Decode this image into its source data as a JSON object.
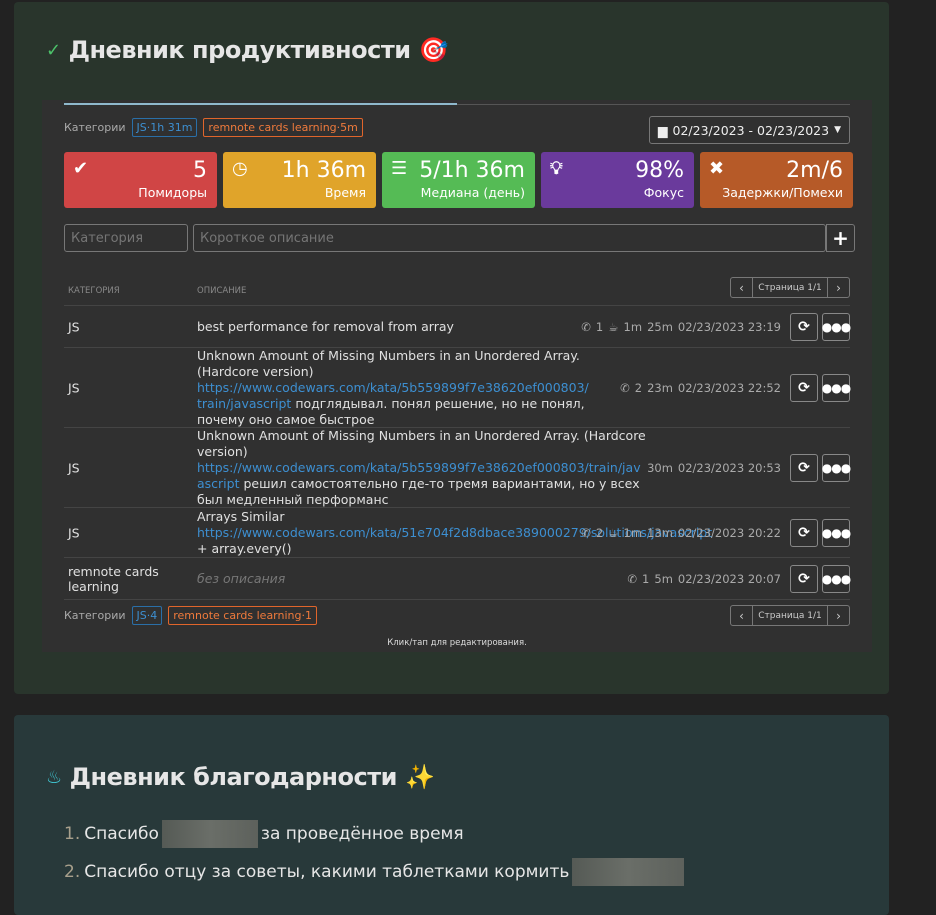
{
  "productivity": {
    "title": "Дневник продуктивности",
    "title_emoji": "🎯",
    "categories_label": "Категории",
    "top_tags": [
      "JS·1h 31m",
      "remnote cards learning·5m"
    ],
    "date_range": "02/23/2023 - 02/23/2023",
    "stats": [
      {
        "value": "5",
        "label": "Помидоры",
        "color": "#d04545",
        "icon": "check-circle-icon"
      },
      {
        "value": "1h 36m",
        "label": "Время",
        "color": "#e0a42a",
        "icon": "clock-icon"
      },
      {
        "value": "5/1h 36m",
        "label": "Медиана (день)",
        "color": "#55bb55",
        "icon": "list-icon"
      },
      {
        "value": "98%",
        "label": "Фокус",
        "color": "#6a3a9c",
        "icon": "lightbulb-icon"
      },
      {
        "value": "2m/6",
        "label": "Задержки/Помехи",
        "color": "#b65a28",
        "icon": "x-icon"
      }
    ],
    "category_placeholder": "Категория",
    "description_placeholder": "Короткое описание",
    "add_label": "+",
    "columns": {
      "category": "КАТЕГОРИЯ",
      "description": "ОПИСАНИЕ"
    },
    "page_label": "Страница 1/1",
    "rows": [
      {
        "category": "JS",
        "title": "best performance for removal from array",
        "link": "",
        "note": "",
        "calls": "1",
        "breaks": "1m",
        "duration": "25m",
        "datetime": "02/23/2023 23:19"
      },
      {
        "category": "JS",
        "title": "Unknown Amount of Missing Numbers in an Unordered Array. (Hardcore version)",
        "link": "https://www.codewars.com/kata/5b559899f7e38620ef000803/train/javascript",
        "note": "подглядывал. понял решение, но не понял, почему оно самое быстрое",
        "calls": "2",
        "breaks": "",
        "duration": "23m",
        "datetime": "02/23/2023 22:52"
      },
      {
        "category": "JS",
        "title": "Unknown Amount of Missing Numbers in an Unordered Array. (Hardcore version)",
        "link": "https://www.codewars.com/kata/5b559899f7e38620ef000803/train/javascript",
        "note": "решил самостоятельно где-то тремя вариантами, но у всех был медленный перформанс",
        "calls": "",
        "breaks": "",
        "duration": "30m",
        "datetime": "02/23/2023 20:53"
      },
      {
        "category": "JS",
        "title": "Arrays Similar",
        "link": "https://www.codewars.com/kata/51e704f2d8dbace389000279/solutions/javascript",
        "note": "+ array.every()",
        "calls": "2",
        "breaks": "1m",
        "duration": "13m",
        "datetime": "02/23/2023 20:22"
      },
      {
        "category": "remnote cards learning",
        "title": "без описания",
        "link": "",
        "note": "",
        "calls": "1",
        "breaks": "",
        "duration": "5m",
        "datetime": "02/23/2023 20:07"
      }
    ],
    "bottom_tags": [
      "JS·4",
      "remnote cards learning·1"
    ],
    "hint": "Клик/тап для редактирования."
  },
  "gratitude": {
    "title": "Дневник благодарности",
    "title_emoji": "✨",
    "items": [
      {
        "n": "1.",
        "before": "Спасибо",
        "after": "за проведённое время"
      },
      {
        "n": "2.",
        "before": "Спасибо отцу за советы, какими таблетками кормить",
        "after": ""
      }
    ]
  }
}
